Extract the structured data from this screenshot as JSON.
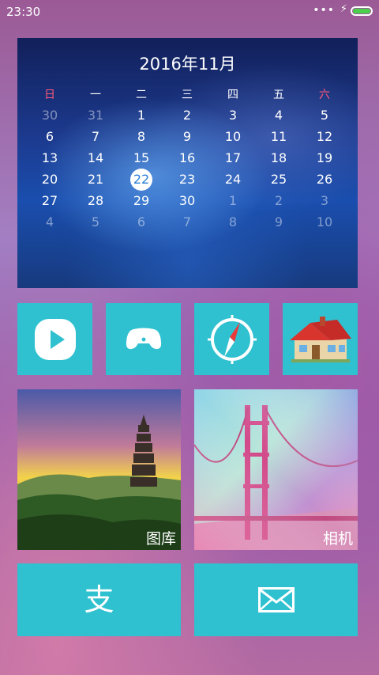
{
  "status_bar": {
    "time": "23:30",
    "dots": "•••",
    "bolt": "⚡",
    "battery_level": 1.0,
    "battery_color": "#4ccf4c"
  },
  "calendar": {
    "title": "2016年11月",
    "weekdays": [
      "日",
      "一",
      "二",
      "三",
      "四",
      "五",
      "六"
    ],
    "weeks": [
      [
        "30",
        "31",
        "1",
        "2",
        "3",
        "4",
        "5"
      ],
      [
        "6",
        "7",
        "8",
        "9",
        "10",
        "11",
        "12"
      ],
      [
        "13",
        "14",
        "15",
        "16",
        "17",
        "18",
        "19"
      ],
      [
        "20",
        "21",
        "22",
        "23",
        "24",
        "25",
        "26"
      ],
      [
        "27",
        "28",
        "29",
        "30",
        "1",
        "2",
        "3"
      ],
      [
        "4",
        "5",
        "6",
        "7",
        "8",
        "9",
        "10"
      ]
    ],
    "today": "22"
  },
  "apps": [
    {
      "icon": "play-icon"
    },
    {
      "icon": "gamepad-icon"
    },
    {
      "icon": "compass-icon"
    },
    {
      "icon": "house-icon"
    }
  ],
  "photos": {
    "gallery_label": "图库",
    "camera_label": "相机"
  },
  "bottom": {
    "alipay_glyph": "支",
    "mail_icon": "mail-icon"
  },
  "colors": {
    "tile": "#2fc1d0",
    "weekend": "#ff5a7a",
    "today_text": "#2a7fd6"
  }
}
